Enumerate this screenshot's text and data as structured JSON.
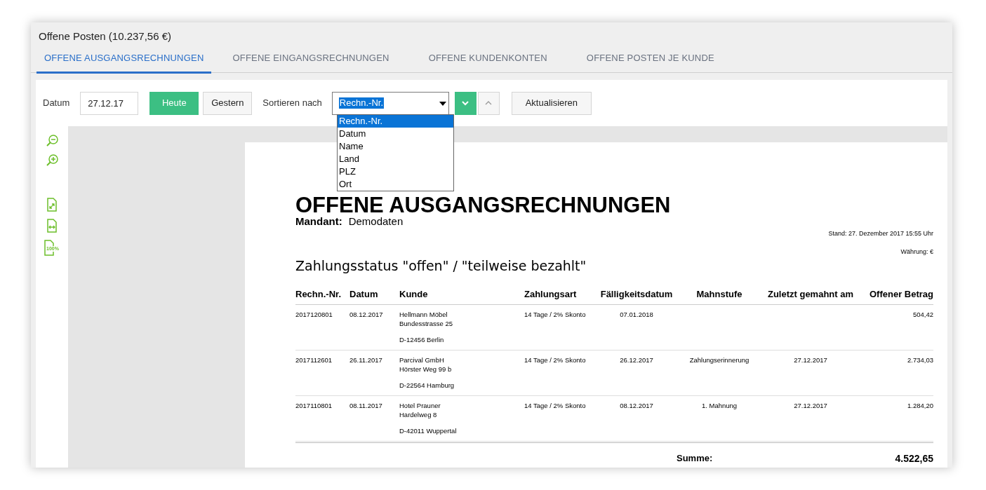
{
  "window": {
    "title": "Offene Posten (10.237,56 €)"
  },
  "tabs": [
    {
      "label": "OFFENE AUSGANGSRECHNUNGEN",
      "selected": true
    },
    {
      "label": "OFFENE EINGANGSRECHNUNGEN",
      "selected": false
    },
    {
      "label": "OFFENE KUNDENKONTEN",
      "selected": false
    },
    {
      "label": "OFFENE POSTEN JE KUNDE",
      "selected": false
    }
  ],
  "toolbar": {
    "date_label": "Datum",
    "date_value": "27.12.17",
    "today_button": "Heute",
    "yesterday_button": "Gestern",
    "sort_label": "Sortieren nach",
    "sort_value": "Rechn.-Nr.",
    "sort_descending": true,
    "refresh_button": "Aktualisieren",
    "sort_options": [
      {
        "label": "Rechn.-Nr.",
        "selected": true
      },
      {
        "label": "Datum",
        "selected": false
      },
      {
        "label": "Name",
        "selected": false
      },
      {
        "label": "Land",
        "selected": false
      },
      {
        "label": "PLZ",
        "selected": false
      },
      {
        "label": "Ort",
        "selected": false
      }
    ]
  },
  "side_tools": [
    {
      "kind": "zoom-out"
    },
    {
      "kind": "zoom-in"
    },
    {
      "kind": "fit-page"
    },
    {
      "kind": "fit-width"
    },
    {
      "kind": "actual-size",
      "label": "100%"
    }
  ],
  "report": {
    "title": "OFFENE AUSGANGSRECHNUNGEN",
    "client_label": "Mandant:",
    "client": "Demodaten",
    "stand": "Stand:  27. Dezember 2017 15:55 Uhr",
    "currency": "Währung: €",
    "subtitle": "Zahlungsstatus \"offen\" / \"teilweise bezahlt\"",
    "columns": [
      "Rechn.-Nr.",
      "Datum",
      "Kunde",
      "Zahlungsart",
      "Fälligkeitsdatum",
      "Mahnstufe",
      "Zuletzt gemahnt am",
      "Offener Betrag"
    ],
    "rows": [
      {
        "number": "2017120801",
        "date": "08.12.2017",
        "customer": [
          "Hellmann Möbel",
          "Bundesstrasse 25",
          "D-12456 Berlin"
        ],
        "payment": "14 Tage / 2% Skonto",
        "due": "07.01.2018",
        "dunning": "",
        "last_dunned": "",
        "amount": "504,42"
      },
      {
        "number": "2017112601",
        "date": "26.11.2017",
        "customer": [
          "Parcival GmbH",
          "Hörster Weg 99 b",
          "D-22564 Hamburg"
        ],
        "payment": "14 Tage / 2% Skonto",
        "due": "26.12.2017",
        "dunning": "Zahlungserinnerung",
        "last_dunned": "27.12.2017",
        "amount": "2.734,03"
      },
      {
        "number": "2017110801",
        "date": "08.11.2017",
        "customer": [
          "Hotel Prauner",
          "Hardelweg 8",
          "D-42011 Wuppertal"
        ],
        "payment": "14 Tage / 2% Skonto",
        "due": "08.12.2017",
        "dunning": "1. Mahnung",
        "last_dunned": "27.12.2017",
        "amount": "1.284,20"
      }
    ],
    "sum_label": "Summe:",
    "sum": "4.522,65"
  }
}
